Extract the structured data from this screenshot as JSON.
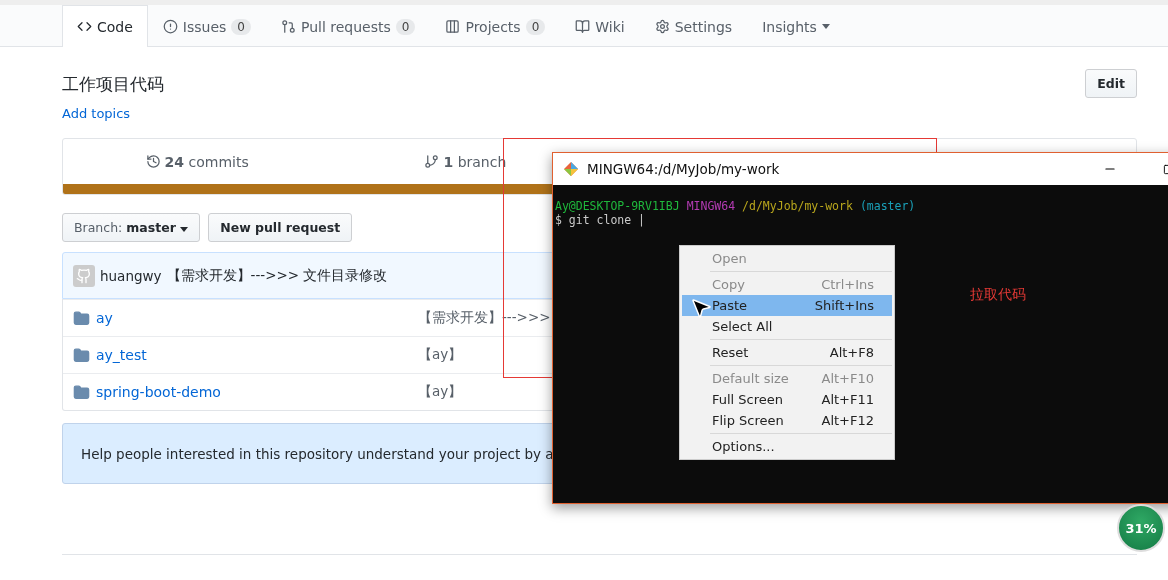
{
  "tabs": [
    {
      "kind": "code",
      "label": "Code",
      "selected": true
    },
    {
      "kind": "issue",
      "label": "Issues",
      "count": "0",
      "selected": false
    },
    {
      "kind": "pr",
      "label": "Pull requests",
      "count": "0",
      "selected": false
    },
    {
      "kind": "project",
      "label": "Projects",
      "count": "0",
      "selected": false
    },
    {
      "kind": "wiki",
      "label": "Wiki",
      "selected": false
    },
    {
      "kind": "settings",
      "label": "Settings",
      "selected": false
    },
    {
      "kind": "menu",
      "label": "Insights",
      "dropdown": true,
      "selected": false
    }
  ],
  "repo": {
    "description": "工作项目代码",
    "add_topics": "Add topics",
    "edit_button": "Edit"
  },
  "stats": [
    {
      "kind": "history",
      "text": "**24** commits"
    },
    {
      "kind": "branch",
      "text": "**1** branch"
    }
  ],
  "branch_button": {
    "label": "Branch:",
    "value": "master"
  },
  "new_pr_button": "New pull request",
  "latest_commit": {
    "author": "huangwy",
    "message": "【需求开发】--->>> 文件目录修改"
  },
  "files": [
    {
      "name": "ay",
      "message": "【需求开发】--->>>"
    },
    {
      "name": "ay_test",
      "message": "【ay】"
    },
    {
      "name": "spring-boot-demo",
      "message": "【ay】"
    }
  ],
  "help_text": "Help people interested in this repository understand your project by a",
  "terminal": {
    "title": "MINGW64:/d/MyJob/my-work",
    "prompt": [
      {
        "text": "Ay@DESKTOP-9RV1IBJ",
        "color": "#1fb83c"
      },
      {
        "text": "MINGW64",
        "color": "#b43bb4"
      },
      {
        "text": "/d/MyJob/my-work",
        "color": "#b8a61c"
      },
      {
        "text": "(master)",
        "color": "#1aa0b8"
      }
    ],
    "command": "$ git clone |"
  },
  "context_menu": [
    [
      {
        "label": "Open",
        "disabled": true,
        "selected": false
      }
    ],
    [
      {
        "label": "Copy",
        "shortcut": "Ctrl+Ins",
        "disabled": true,
        "selected": false
      },
      {
        "label": "Paste",
        "shortcut": "Shift+Ins",
        "disabled": false,
        "selected": true
      },
      {
        "label": "Select All",
        "disabled": false,
        "selected": false
      }
    ],
    [
      {
        "label": "Reset",
        "shortcut": "Alt+F8",
        "disabled": false,
        "selected": false
      }
    ],
    [
      {
        "label": "Default size",
        "shortcut": "Alt+F10",
        "disabled": true,
        "selected": false
      },
      {
        "label": "Full Screen",
        "shortcut": "Alt+F11",
        "disabled": false,
        "selected": false
      },
      {
        "label": "Flip Screen",
        "shortcut": "Alt+F12",
        "disabled": false,
        "selected": false
      }
    ],
    [
      {
        "label": "Options...",
        "disabled": false,
        "selected": false
      }
    ]
  ],
  "annotation": "拉取代码",
  "progress_badge": "31%"
}
